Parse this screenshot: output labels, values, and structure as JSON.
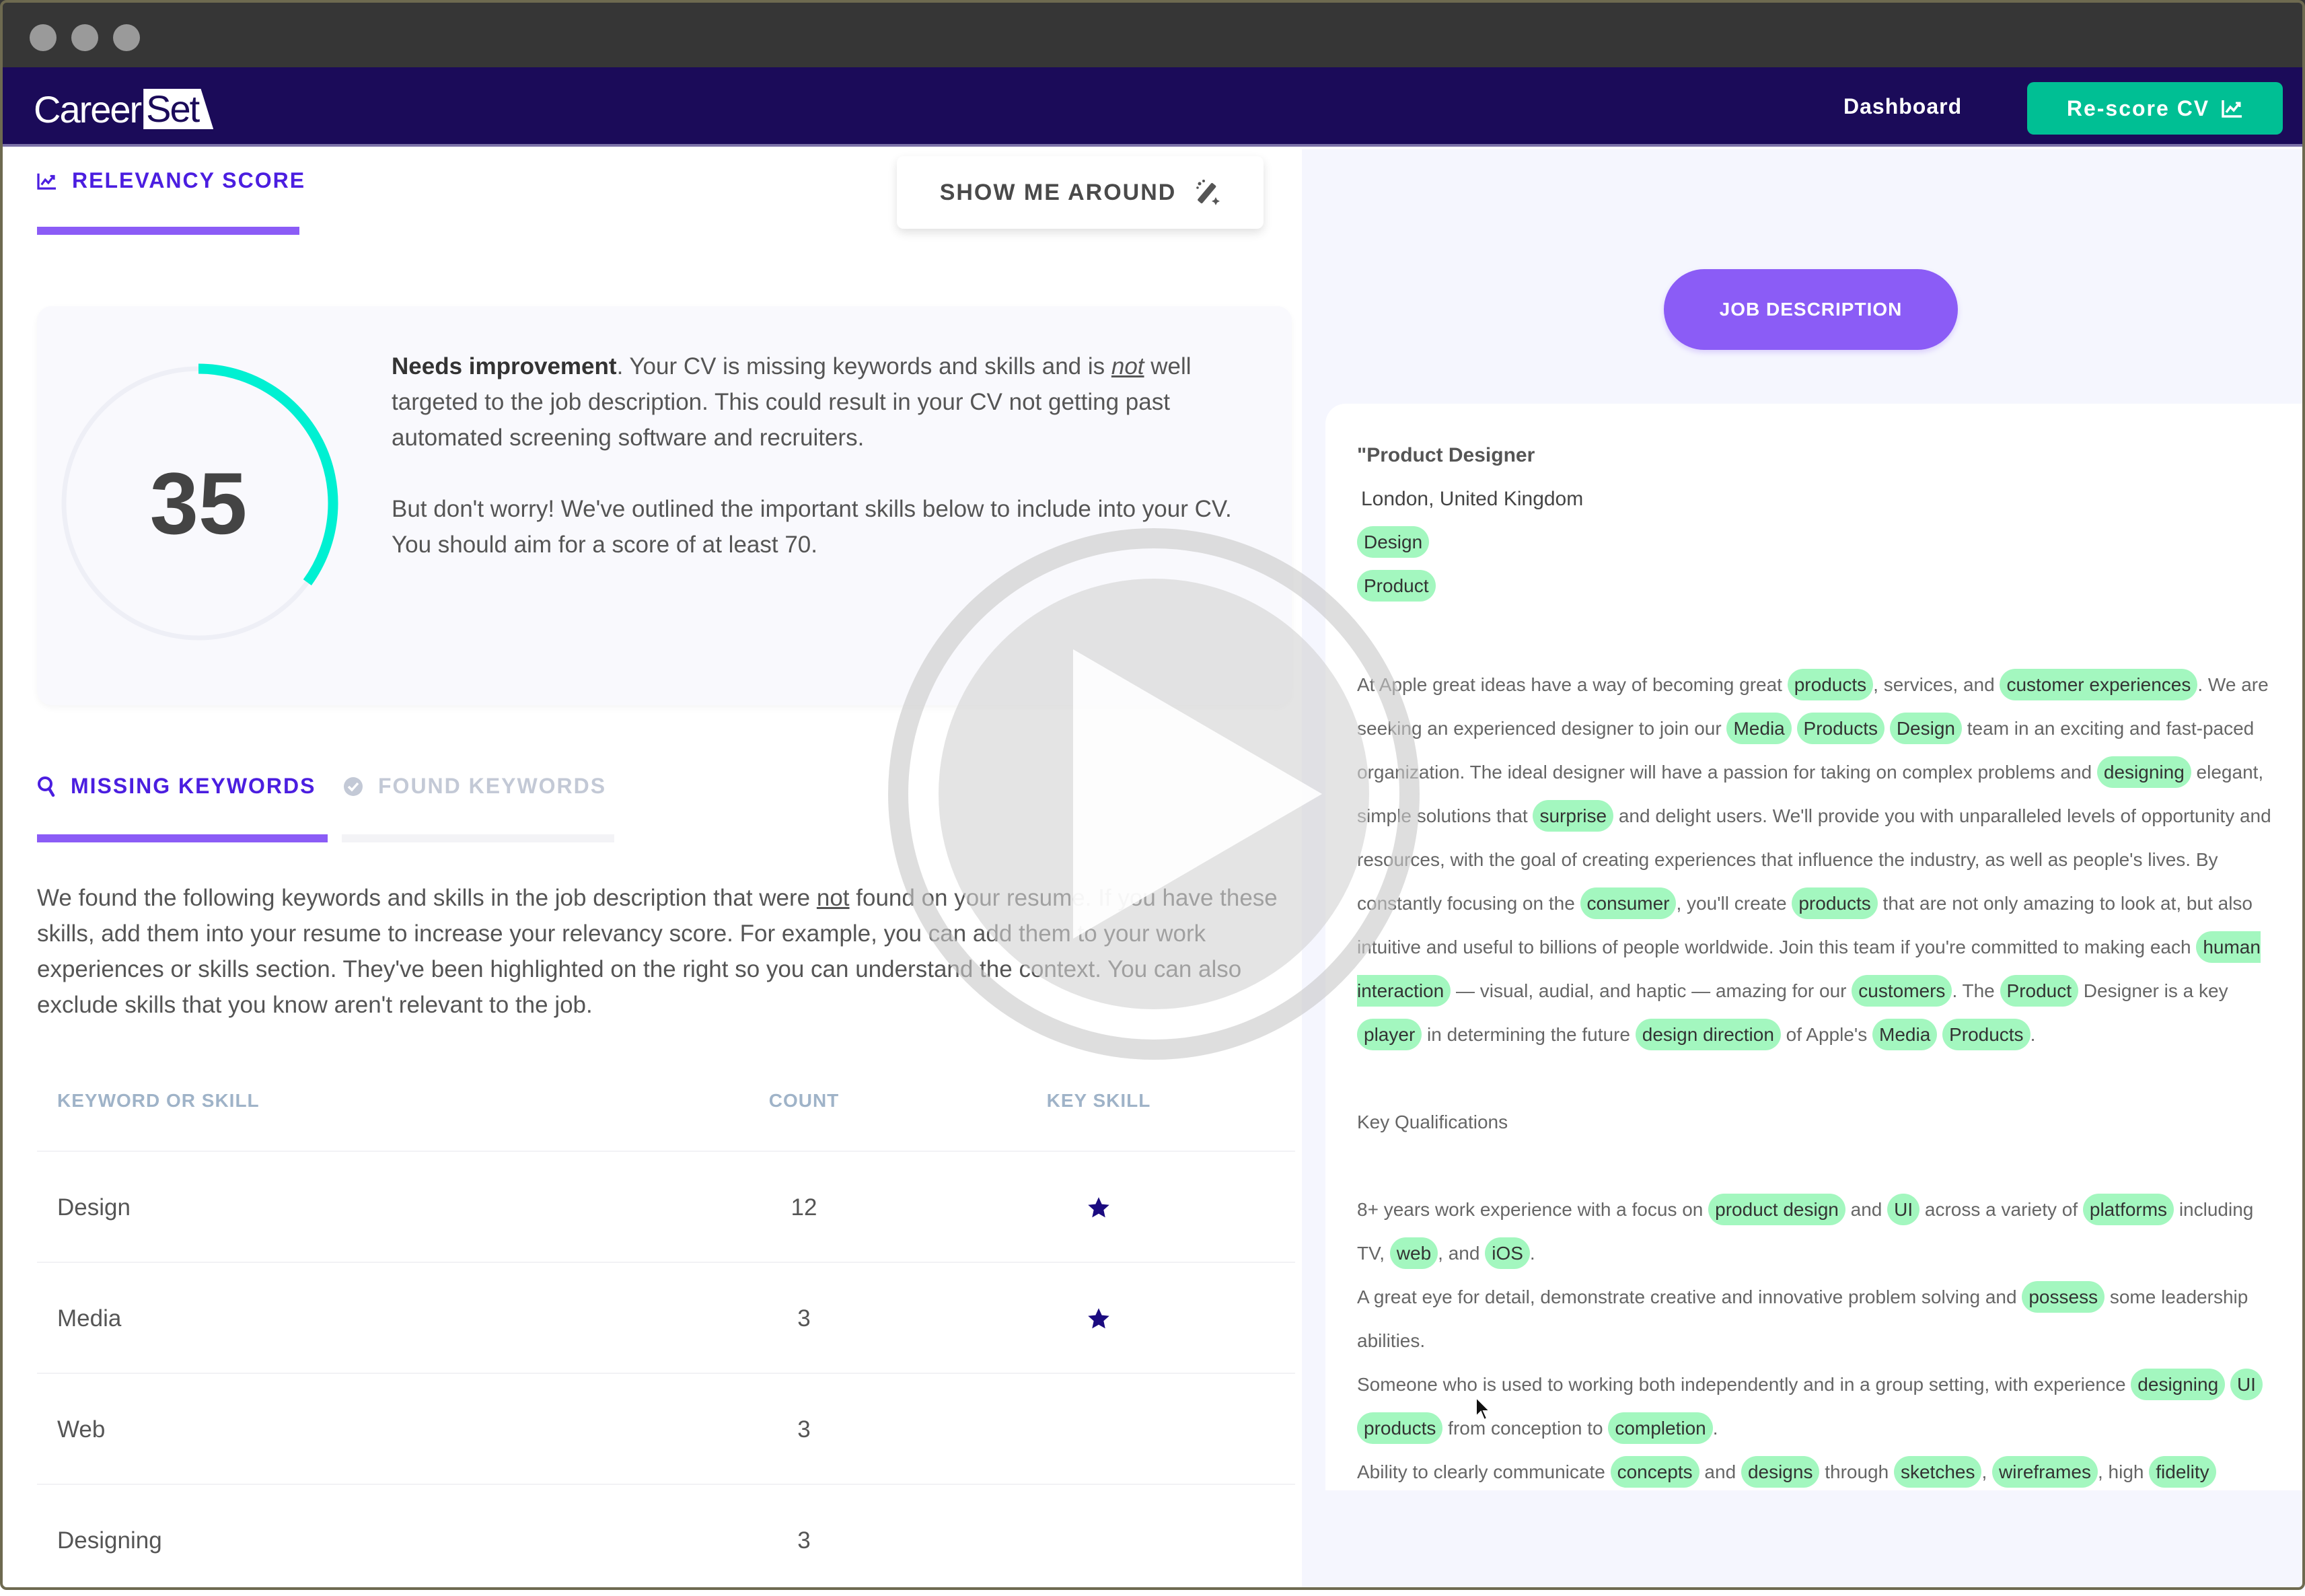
{
  "window": {
    "controls": [
      "close",
      "minimize",
      "maximize"
    ]
  },
  "nav": {
    "logo_part1": "Career",
    "logo_part2": "Set",
    "dashboard_label": "Dashboard",
    "rescore_label": "Re-score CV",
    "rescore_icon": "chart-line-icon",
    "brand_color": "#1b0b59",
    "accent_color": "#00bf94"
  },
  "relevancy": {
    "tab_label": "RELEVANCY SCORE",
    "tab_icon": "chart-line-icon",
    "show_me_around_label": "SHOW ME AROUND",
    "show_me_around_icon": "magic-wand-icon",
    "score": 35,
    "score_max": 100,
    "gauge_color": "#00f0d2",
    "status_bold": "Needs improvement",
    "status_text_1": ". Your CV is missing keywords and skills and is ",
    "status_emph": "not",
    "status_text_2": " well targeted to the job description. This could result in your CV not getting past automated screening software and recruiters.",
    "advice": "But don't worry! We've outlined the important skills below to include into your CV. You should aim for a score of at least 70."
  },
  "keywords": {
    "tabs": [
      {
        "label": "MISSING KEYWORDS",
        "icon": "search-icon",
        "active": true
      },
      {
        "label": "FOUND KEYWORDS",
        "icon": "check-circle-icon",
        "active": false
      }
    ],
    "desc_1": "We found the following keywords and skills in the job description that were ",
    "desc_emph": "not",
    "desc_2": " found on your resume. If you have these skills, add them into your resume to increase your relevancy score. For example, you can add them to your work experiences or skills section. They've been highlighted on the right so you can understand the context. You can also exclude skills that you know aren't relevant to the job.",
    "table": {
      "headers": [
        "KEYWORD OR SKILL",
        "COUNT",
        "KEY SKILL"
      ],
      "rows": [
        {
          "keyword": "Design",
          "count": "12",
          "key_skill": true
        },
        {
          "keyword": "Media",
          "count": "3",
          "key_skill": true
        },
        {
          "keyword": "Web",
          "count": "3",
          "key_skill": false
        },
        {
          "keyword": "Designing",
          "count": "3",
          "key_skill": false
        }
      ]
    }
  },
  "job_description": {
    "button_label": "JOB DESCRIPTION",
    "title": "\"Product Designer",
    "location": "London, United Kingdom",
    "tags": [
      "Design",
      "Product"
    ],
    "paragraphs": [
      [
        {
          "t": "At Apple great ideas have a way of becoming great "
        },
        {
          "t": "products",
          "hl": true
        },
        {
          "t": ", services, and "
        },
        {
          "t": "customer  experiences",
          "hl": true
        },
        {
          "t": ". We are seeking an experienced designer to join our "
        },
        {
          "t": "Media",
          "hl": true
        },
        {
          "t": " "
        },
        {
          "t": "Products",
          "hl": true
        },
        {
          "t": " "
        },
        {
          "t": "Design",
          "hl": true
        },
        {
          "t": " team in an exciting and fast-paced organization. The ideal designer will have a passion for taking on complex problems and "
        },
        {
          "t": "designing",
          "hl": true
        },
        {
          "t": " elegant, simple solutions that "
        },
        {
          "t": "surprise",
          "hl": true
        },
        {
          "t": " and delight users. We'll provide you with unparalleled levels of opportunity and resources, with the goal of creating experiences that influence the industry, as well as people's lives. By constantly focusing on the "
        },
        {
          "t": "consumer",
          "hl": true
        },
        {
          "t": ", you'll create "
        },
        {
          "t": "products",
          "hl": true
        },
        {
          "t": " that are not only amazing to look at, but also intuitive and useful to billions of people worldwide. Join this team if you're committed to making each "
        },
        {
          "t": "human  interaction",
          "hl": true
        },
        {
          "t": " — visual, audial, and haptic — amazing for our "
        },
        {
          "t": "customers",
          "hl": true
        },
        {
          "t": ". The "
        },
        {
          "t": "Product",
          "hl": true
        },
        {
          "t": " Designer is a key "
        },
        {
          "t": "player",
          "hl": true
        },
        {
          "t": " in determining the future "
        },
        {
          "t": "design  direction",
          "hl": true
        },
        {
          "t": " of Apple's "
        },
        {
          "t": "Media",
          "hl": true
        },
        {
          "t": " "
        },
        {
          "t": "Products",
          "hl": true
        },
        {
          "t": "."
        }
      ]
    ],
    "section_heading": "Key Qualifications",
    "qualifications": [
      [
        {
          "t": "8+ years work experience with a focus on "
        },
        {
          "t": "product  design",
          "hl": true
        },
        {
          "t": " and "
        },
        {
          "t": "UI",
          "hl": true
        },
        {
          "t": " across a variety of "
        },
        {
          "t": "platforms",
          "hl": true
        },
        {
          "t": " including TV, "
        },
        {
          "t": "web",
          "hl": true
        },
        {
          "t": ", and "
        },
        {
          "t": "iOS",
          "hl": true
        },
        {
          "t": "."
        }
      ],
      [
        {
          "t": "A great eye for detail, demonstrate creative and innovative problem solving and "
        },
        {
          "t": "possess",
          "hl": true
        },
        {
          "t": " some leadership abilities."
        }
      ],
      [
        {
          "t": "Someone who is used to working both independently and in a group setting, with experience "
        },
        {
          "t": "designing",
          "hl": true
        },
        {
          "t": " "
        },
        {
          "t": "UI",
          "hl": true
        },
        {
          "t": " "
        },
        {
          "t": "products",
          "hl": true
        },
        {
          "t": " from conception to "
        },
        {
          "t": "completion",
          "hl": true
        },
        {
          "t": "."
        }
      ],
      [
        {
          "t": "Ability to clearly communicate "
        },
        {
          "t": "concepts",
          "hl": true
        },
        {
          "t": " and "
        },
        {
          "t": "designs",
          "hl": true
        },
        {
          "t": " through "
        },
        {
          "t": "sketches",
          "hl": true
        },
        {
          "t": ", "
        },
        {
          "t": "wireframes",
          "hl": true
        },
        {
          "t": ", high "
        },
        {
          "t": "fidelity",
          "hl": true
        }
      ]
    ],
    "highlight_color": "#a3f7bf"
  },
  "overlay": {
    "icon": "play-icon"
  }
}
